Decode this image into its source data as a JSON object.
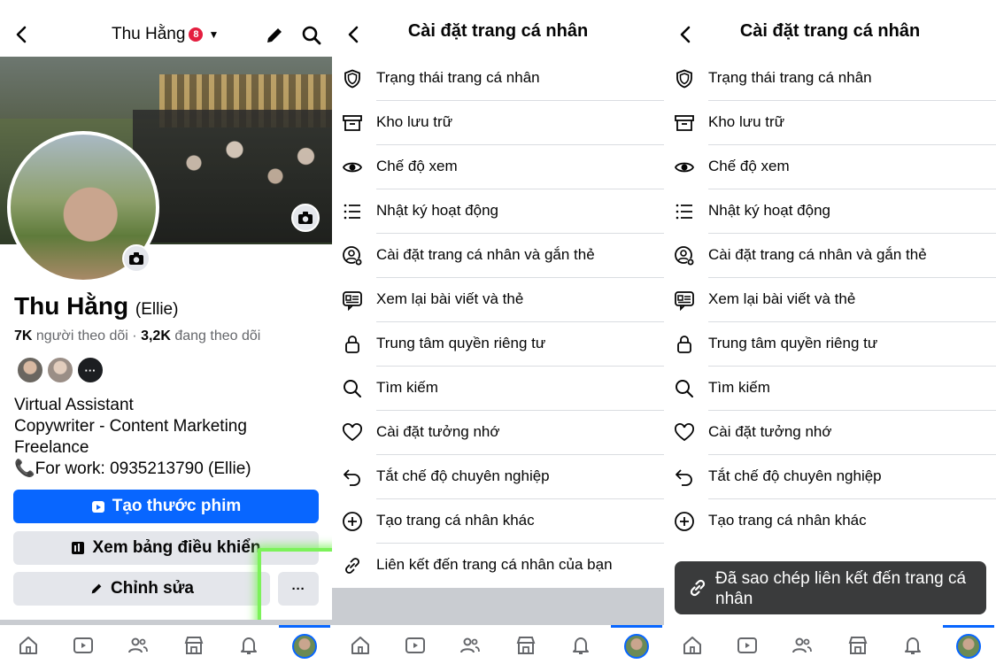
{
  "colors": {
    "accent": "#0866ff",
    "badge": "#e41e3f",
    "highlight": "#7cf25a",
    "toast_bg": "#3a3b3c"
  },
  "profile": {
    "header_name": "Thu Hằng",
    "notification_count": "8",
    "name": "Thu Hằng",
    "alt_name": "(Ellie)",
    "followers_count": "7K",
    "followers_label": "người theo dõi",
    "separator": "·",
    "following_count": "3,2K",
    "following_label": "đang theo dõi",
    "more_friends": "···",
    "bio": [
      "Virtual Assistant",
      "Copywriter - Content Marketing",
      "Freelance",
      "📞For work: 0935213790 (Ellie)"
    ],
    "btn_reel": "Tạo thước phim",
    "btn_dashboard": "Xem bảng điều khiển",
    "btn_edit": "Chỉnh sửa",
    "btn_more": "···"
  },
  "settings": {
    "title": "Cài đặt trang cá nhân",
    "items": [
      {
        "label": "Trạng thái trang cá nhân",
        "icon": "shield-icon"
      },
      {
        "label": "Kho lưu trữ",
        "icon": "archive-icon"
      },
      {
        "label": "Chế độ xem",
        "icon": "eye-icon"
      },
      {
        "label": "Nhật ký hoạt động",
        "icon": "list-icon"
      },
      {
        "label": "Cài đặt trang cá nhân và gắn thẻ",
        "icon": "profile-gear-icon"
      },
      {
        "label": "Xem lại bài viết và thẻ",
        "icon": "review-icon"
      },
      {
        "label": "Trung tâm quyền riêng tư",
        "icon": "lock-icon"
      },
      {
        "label": "Tìm kiếm",
        "icon": "search-icon"
      },
      {
        "label": "Cài đặt tưởng nhớ",
        "icon": "heart-icon"
      },
      {
        "label": "Tắt chế độ chuyên nghiệp",
        "icon": "undo-icon"
      },
      {
        "label": "Tạo trang cá nhân khác",
        "icon": "plus-circle-icon"
      },
      {
        "label": "Liên kết đến trang cá nhân của bạn",
        "icon": "link-icon"
      }
    ]
  },
  "toast": {
    "message": "Đã sao chép liên kết đến trang cá nhân",
    "icon": "link-icon"
  },
  "nav": [
    "home-icon",
    "video-icon",
    "friends-icon",
    "marketplace-icon",
    "bell-icon",
    "profile-avatar"
  ]
}
